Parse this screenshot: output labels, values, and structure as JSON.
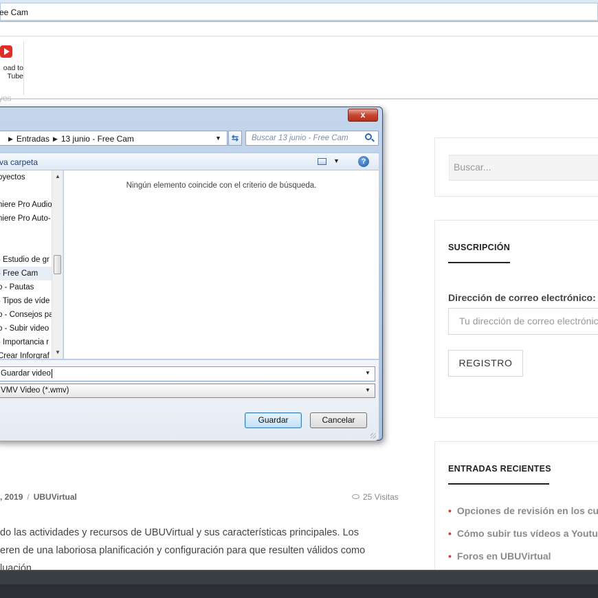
{
  "window": {
    "title": "ee Cam",
    "youtube_label_line1": "oad to",
    "youtube_label_line2": "Tube",
    "partial_text": "yos"
  },
  "dialog": {
    "close_glyph": "x",
    "breadcrumb": [
      "Entradas",
      "13 junio - Free Cam"
    ],
    "search_placeholder": "Buscar 13 junio - Free Cam",
    "new_folder_label": "va carpeta",
    "help_glyph": "?",
    "nav_items": [
      "oyectos",
      "",
      "niere Pro Audio",
      "niere Pro Auto-",
      "",
      "",
      "- Estudio de gr",
      "- Free Cam",
      "o - Pautas",
      "- Tipos de víde",
      "o - Consejos pa",
      "o - Subir video a",
      "- Importancia r",
      "Crear Inforgraf"
    ],
    "selected_nav_index": 7,
    "empty_message": "Ningún elemento coincide con el criterio de búsqueda.",
    "filename_value": "Guardar video",
    "filetype_value": "VMV Video (*.wmv)",
    "save_label": "Guardar",
    "cancel_label": "Cancelar"
  },
  "article": {
    "date_fragment": ", 2019",
    "category": "UBUVirtual",
    "views": "25 Visitas",
    "paragraph_lines": [
      "do las actividades y recursos de UBUVirtual y sus características principales. Los",
      "eren de una laboriosa planificación y configuración para que resulten válidos como",
      "luación."
    ]
  },
  "sidebar": {
    "search_placeholder": "Buscar...",
    "subscription_title": "SUSCRIPCIÓN",
    "email_label": "Dirección de correo electrónico:",
    "email_placeholder": "Tu dirección de correo electrónico",
    "register_label": "REGISTRO",
    "recent_title": "ENTRADAS RECIENTES",
    "recent_items": [
      "Opciones de revisión en los cu",
      "Cómo subir tus vídeos a Youtu",
      "Foros en UBUVirtual"
    ]
  },
  "colors": {
    "accent_red": "#d43a3a",
    "dialog_frame": "#aac2df",
    "taskbar": "#2b2f33"
  }
}
